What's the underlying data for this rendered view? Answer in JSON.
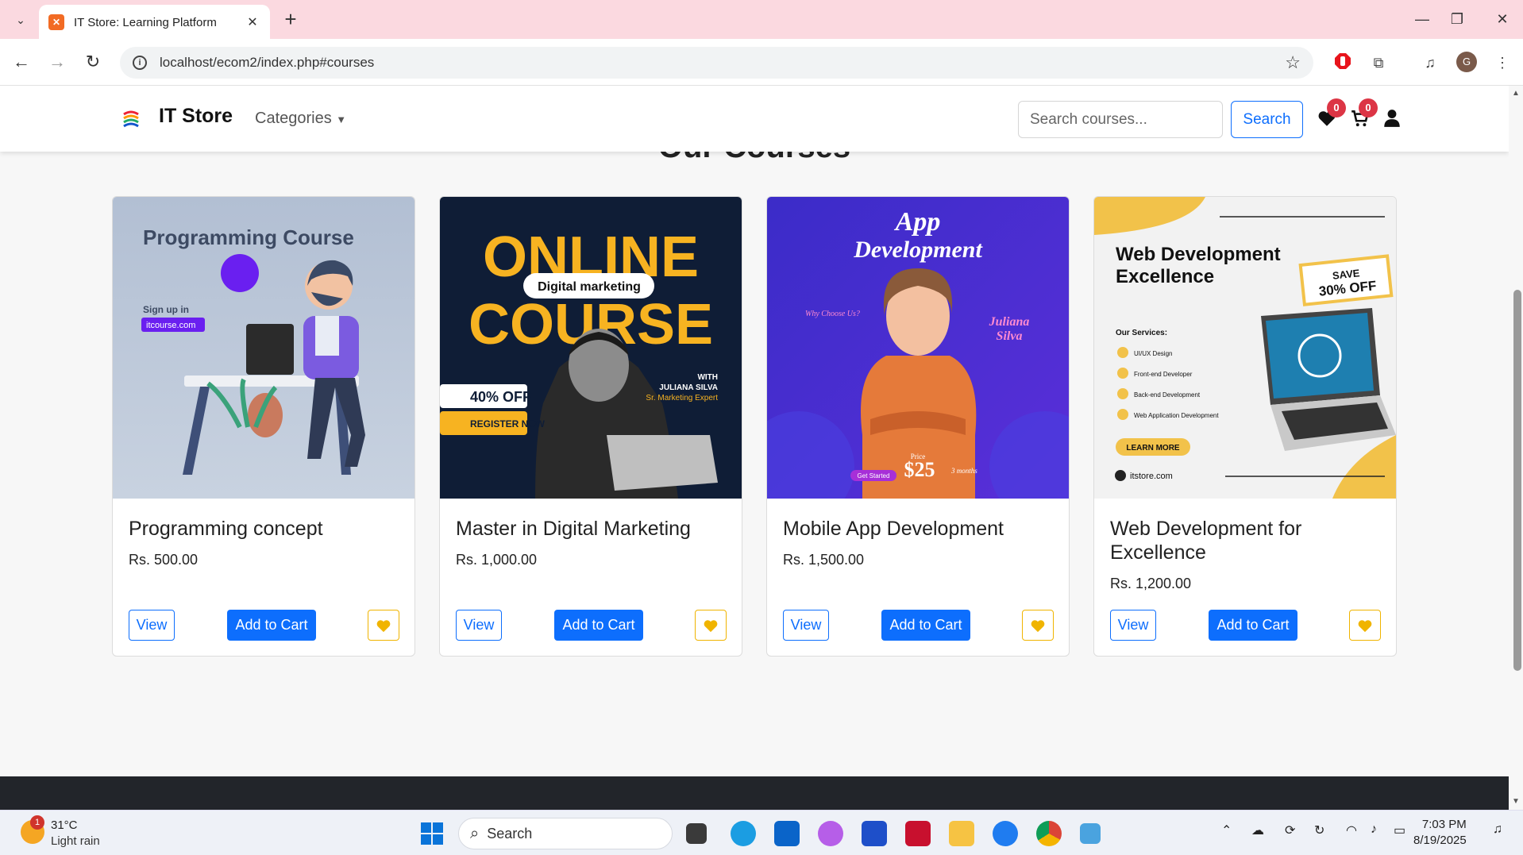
{
  "browser": {
    "tab_title": "IT Store: Learning Platform",
    "url": "localhost/ecom2/index.php#courses",
    "profile_initial": "G"
  },
  "site": {
    "brand": "IT Store",
    "categories_label": "Categories",
    "search_placeholder": "Search courses...",
    "search_button": "Search",
    "wishlist_count": "0",
    "cart_count": "0"
  },
  "section_title": "Our Courses",
  "courses": [
    {
      "title": "Programming concept",
      "price": "Rs. 500.00",
      "view": "View",
      "add": "Add to Cart",
      "poster": {
        "heading": "Programming Course",
        "line1": "Sign up in",
        "line2": "itcourse.com"
      }
    },
    {
      "title": "Master in Digital Marketing",
      "price": "Rs. 1,000.00",
      "view": "View",
      "add": "Add to Cart",
      "poster": {
        "heading1": "ONLINE",
        "heading2": "COURSE",
        "pill": "Digital marketing",
        "offer": "40% OFF",
        "cta": "REGISTER NOW",
        "with": "WITH",
        "name": "JULIANA SILVA",
        "role": "Sr. Marketing Expert"
      }
    },
    {
      "title": "Mobile App Development",
      "price": "Rs. 1,500.00",
      "view": "View",
      "add": "Add to Cart",
      "poster": {
        "heading1": "App",
        "heading2": "Development",
        "name1": "Juliana",
        "name2": "Silva",
        "why": "Why Choose Us?",
        "price_label": "Price",
        "price": "$25",
        "months": "3 months",
        "cta": "Get Started"
      }
    },
    {
      "title": "Web Development for Excellence",
      "price": "Rs. 1,200.00",
      "view": "View",
      "add": "Add to Cart",
      "poster": {
        "heading1": "Web Development",
        "heading2": "Excellence",
        "save1": "SAVE",
        "save2": "30% OFF",
        "services_title": "Our Services:",
        "services": [
          "UI/UX Design",
          "Front-end Developer",
          "Back-end Development",
          "Web Application Development"
        ],
        "cta": "LEARN MORE",
        "site": "itstore.com"
      }
    }
  ],
  "taskbar": {
    "temp": "31°C",
    "condition": "Light rain",
    "weather_badge": "1",
    "search": "Search",
    "time": "7:03 PM",
    "date": "8/19/2025"
  }
}
